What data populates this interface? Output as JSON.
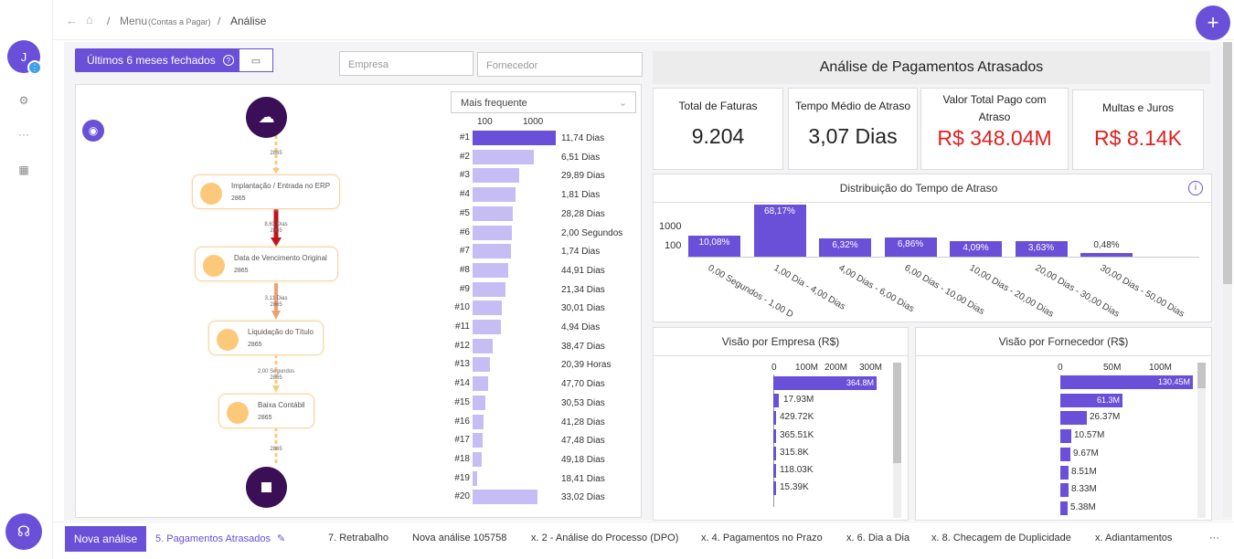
{
  "sidebar": {
    "avatar_letter": "J",
    "avatar_badge": "⋮",
    "icons": [
      "gear-icon",
      "more-icon",
      "building-icon"
    ],
    "support_icon": "headset-icon"
  },
  "breadcrumb": {
    "menu": "Menu",
    "menu_sub": "(Contas a Pagar)",
    "sep": "/",
    "current": "Análise"
  },
  "filters": {
    "period_label": "Últimos 6 meses fechados",
    "period_help": "?",
    "empresa_placeholder": "Empresa",
    "fornecedor_placeholder": "Fornecedor"
  },
  "flow": {
    "nodes": [
      {
        "name": "Implantação / Entrada no ERP",
        "count": "2865"
      },
      {
        "name": "Data de Vencimento Original",
        "count": "2865"
      },
      {
        "name": "Liquidação do Título",
        "count": "2865"
      },
      {
        "name": "Baixa Contábil",
        "count": "2865"
      }
    ],
    "edges": [
      {
        "label": "2865"
      },
      {
        "label": "8,63 Dias\n2865"
      },
      {
        "label": "3,11 Dias\n2865"
      },
      {
        "label": "2,00 Segundos\n2865"
      },
      {
        "label": "2865"
      }
    ],
    "sort_select": "Mais frequente",
    "scale": [
      "100",
      "1000"
    ],
    "variants": [
      {
        "rank": "#1",
        "value": "11,74 Dias",
        "freq": 0.93
      },
      {
        "rank": "#2",
        "value": "6,51 Dias",
        "freq": 0.68
      },
      {
        "rank": "#3",
        "value": "29,89 Dias",
        "freq": 0.52
      },
      {
        "rank": "#4",
        "value": "1,81 Dias",
        "freq": 0.48
      },
      {
        "rank": "#5",
        "value": "28,28 Dias",
        "freq": 0.45
      },
      {
        "rank": "#6",
        "value": "2,00 Segundos",
        "freq": 0.44
      },
      {
        "rank": "#7",
        "value": "1,74 Dias",
        "freq": 0.43
      },
      {
        "rank": "#8",
        "value": "44,91 Dias",
        "freq": 0.4
      },
      {
        "rank": "#9",
        "value": "21,34 Dias",
        "freq": 0.37
      },
      {
        "rank": "#10",
        "value": "30,01 Dias",
        "freq": 0.33
      },
      {
        "rank": "#11",
        "value": "4,94 Dias",
        "freq": 0.32
      },
      {
        "rank": "#12",
        "value": "38,47 Dias",
        "freq": 0.22
      },
      {
        "rank": "#13",
        "value": "20,39 Horas",
        "freq": 0.19
      },
      {
        "rank": "#14",
        "value": "47,70 Dias",
        "freq": 0.17
      },
      {
        "rank": "#15",
        "value": "30,53 Dias",
        "freq": 0.14
      },
      {
        "rank": "#16",
        "value": "41,28 Dias",
        "freq": 0.12
      },
      {
        "rank": "#17",
        "value": "47,48 Dias",
        "freq": 0.11
      },
      {
        "rank": "#18",
        "value": "49,18 Dias",
        "freq": 0.1
      },
      {
        "rank": "#19",
        "value": "18,41 Dias",
        "freq": 0.05
      },
      {
        "rank": "#20",
        "value": "33,02 Dias",
        "freq": 0.72
      }
    ]
  },
  "dashboard": {
    "title": "Análise de Pagamentos Atrasados",
    "kpis": [
      {
        "label": "Total de Faturas",
        "value": "9.204",
        "color": "#222222"
      },
      {
        "label": "Tempo Médio de Atraso",
        "value": "3,07 Dias",
        "color": "#222222"
      },
      {
        "label": "Valor Total Pago com Atraso",
        "value": "R$ 348.04M",
        "color": "#e02020"
      },
      {
        "label": "Multas e Juros",
        "value": "R$ 8.14K",
        "color": "#e02020"
      }
    ],
    "dist_title": "Distribuição do Tempo de Atraso",
    "empresa_title": "Visão por Empresa (R$)",
    "fornecedor_title": "Visão por Fornecedor (R$)"
  },
  "chart_data": [
    {
      "type": "bar",
      "title": "Distribuição do Tempo de Atraso",
      "yticks": [
        "100",
        "1000"
      ],
      "categories": [
        "0,00 Segundos - 1,00 D",
        "1,00 Dia - 4,00 Dias",
        "4,00 Dias - 6,00 Dias",
        "6,00 Dias - 10,00 Dias",
        "10,00 Dias - 20,00 Dias",
        "20,00 Dias - 30,00 Dias",
        "30,00 Dias - 50,00 Dias"
      ],
      "labels": [
        "10,08%",
        "68,17%",
        "6,32%",
        "6,86%",
        "4,09%",
        "3,63%",
        "0,48%"
      ],
      "values": [
        928,
        6275,
        582,
        631,
        376,
        334,
        44
      ]
    },
    {
      "type": "bar",
      "orientation": "horizontal",
      "title": "Visão por Empresa (R$)",
      "xticks": [
        "0",
        "100M",
        "200M",
        "300M"
      ],
      "labels": [
        "364.8M",
        "17.93M",
        "429.72K",
        "365.51K",
        "315.8K",
        "118.03K",
        "15.39K"
      ],
      "values": [
        364.8,
        17.93,
        0.43,
        0.37,
        0.32,
        0.12,
        0.02
      ],
      "xlim": [
        0,
        370
      ]
    },
    {
      "type": "bar",
      "orientation": "horizontal",
      "title": "Visão por Fornecedor (R$)",
      "xticks": [
        "0",
        "50M",
        "100M"
      ],
      "labels": [
        "130.45M",
        "61.3M",
        "26.37M",
        "10.57M",
        "9.67M",
        "8.51M",
        "8.33M",
        "5.38M"
      ],
      "values": [
        130.45,
        61.3,
        26.37,
        10.57,
        9.67,
        8.51,
        8.33,
        5.38
      ],
      "xlim": [
        0,
        130.45
      ]
    }
  ],
  "tabs": {
    "new_label": "Nova análise",
    "active": "5. Pagamentos Atrasados",
    "items": [
      "7. Retrabalho",
      "Nova análise 105758",
      "x. 2 - Análise do Processo (DPO)",
      "x. 4. Pagamentos no Prazo",
      "x. 6. Dia a Dia",
      "x. 8. Checagem de Duplicidade",
      "x. Adiantamentos"
    ],
    "more": "···"
  }
}
